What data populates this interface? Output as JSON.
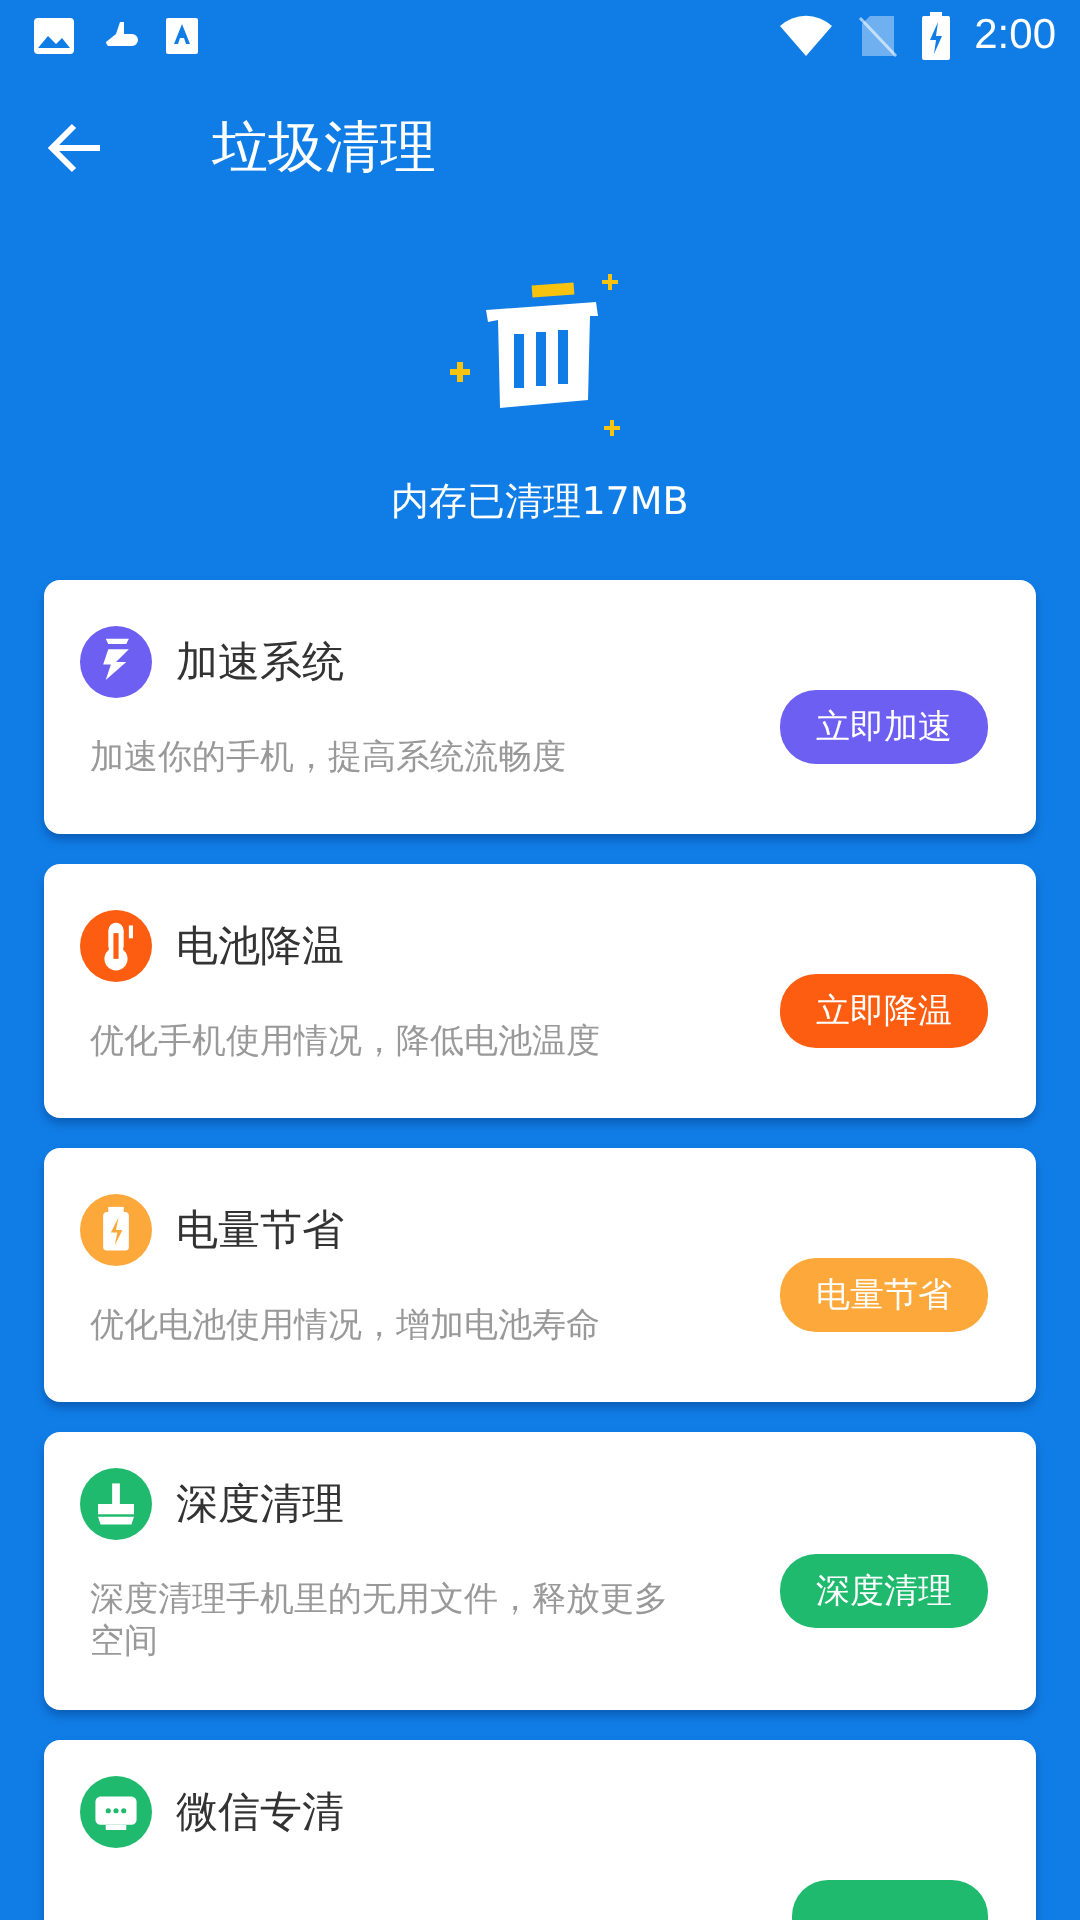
{
  "status_bar": {
    "time": "2:00"
  },
  "toolbar": {
    "title": "垃圾清理"
  },
  "summary": {
    "text": "内存已清理17MB"
  },
  "cards": [
    {
      "kind": "bolt",
      "title": "加速系统",
      "description": "加速你的手机，提高系统流畅度",
      "button": "立即加速",
      "color": "#6c5ff2"
    },
    {
      "kind": "thermometer",
      "title": "电池降温",
      "description": "优化手机使用情况，降低电池温度",
      "button": "立即降温",
      "color": "#fc5d11"
    },
    {
      "kind": "battery",
      "title": "电量节省",
      "description": "优化电池使用情况，增加电池寿命",
      "button": "电量节省",
      "color": "#fda83a"
    },
    {
      "kind": "broom",
      "title": "深度清理",
      "description": "深度清理手机里的无用文件，释放更多空间",
      "button": "深度清理",
      "color": "#1fba6e"
    },
    {
      "kind": "chat",
      "title": "微信专清",
      "color": "#1fba6e"
    }
  ]
}
